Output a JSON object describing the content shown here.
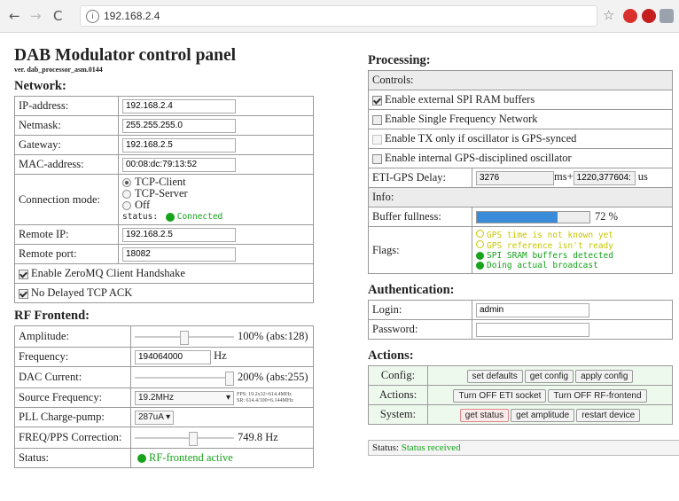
{
  "browser": {
    "url": "192.168.2.4"
  },
  "page": {
    "title": "DAB Modulator control panel",
    "version": "ver. dab_processor_asm.0144"
  },
  "network": {
    "heading": "Network:",
    "ip_label": "IP-address:",
    "ip": "192.168.2.4",
    "netmask_label": "Netmask:",
    "netmask": "255.255.255.0",
    "gateway_label": "Gateway:",
    "gateway": "192.168.2.5",
    "mac_label": "MAC-address:",
    "mac": "00:08:dc:79:13:52",
    "mode_label": "Connection mode:",
    "mode_client": "TCP-Client",
    "mode_server": "TCP-Server",
    "mode_off": "Off",
    "status_label": "status:",
    "status_value": "Connected",
    "remote_ip_label": "Remote IP:",
    "remote_ip": "192.168.2.5",
    "remote_port_label": "Remote port:",
    "remote_port": "18082",
    "zmq_label": "Enable ZeroMQ Client Handshake",
    "nodelay_label": "No Delayed TCP ACK"
  },
  "rf": {
    "heading": "RF Frontend:",
    "amp_label": "Amplitude:",
    "amp_value": "100% (abs:128)",
    "amp_level": 0.5,
    "freq_label": "Frequency:",
    "freq": "194064000",
    "freq_unit": "Hz",
    "dac_label": "DAC Current:",
    "dac_value": "200% (abs:255)",
    "dac_level": 1.0,
    "src_label": "Source Frequency:",
    "src_value": "19.2MHz",
    "fps_line1": "FPS: 19.2x32=614.4MHz",
    "fps_line2": "SR: 614.4/100=6.144MHz",
    "pll_label": "PLL Charge-pump:",
    "pll_value": "287uA",
    "corr_label": "FREQ/PPS Correction:",
    "corr_value": "749.8 Hz",
    "corr_level": 0.6,
    "status_label": "Status:",
    "status_value": "RF-frontend active"
  },
  "processing": {
    "heading": "Processing:",
    "controls_label": "Controls:",
    "spi_label": "Enable external SPI RAM buffers",
    "sfn_label": "Enable Single Frequency Network",
    "tx_label": "Enable TX only if oscillator is GPS-synced",
    "gpsosc_label": "Enable internal GPS-disciplined oscillator",
    "eti_label": "ETI-GPS Delay:",
    "eti_ms": "3276",
    "ms_plus": "ms+",
    "eti_us": "1220,377604:",
    "us": "us",
    "info_label": "Info:",
    "buffer_label": "Buffer fullness:",
    "buffer_pct": "72 %",
    "buffer_level": 0.72,
    "flags_label": "Flags:",
    "flags": [
      "GPS time is not known yet",
      "GPS reference isn't ready",
      "SPI SRAM buffers detected",
      "Doing actual broadcast"
    ]
  },
  "auth": {
    "heading": "Authentication:",
    "login_label": "Login:",
    "login": "admin",
    "password_label": "Password:",
    "password": ""
  },
  "actions": {
    "heading": "Actions:",
    "config_label": "Config:",
    "set_defaults": "set defaults",
    "get_config": "get config",
    "apply_config": "apply config",
    "actions_label": "Actions:",
    "off_eti": "Turn OFF ETI socket",
    "off_rf": "Turn OFF RF-frontend",
    "system_label": "System:",
    "get_status": "get status",
    "get_amplitude": "get amplitude",
    "restart": "restart device"
  },
  "status_bar": {
    "label": "Status:",
    "value": "Status received"
  },
  "colors": {
    "green": "#16a21b",
    "bar_fill": "#3a8bd8",
    "flag_warn": "#c7c700"
  }
}
